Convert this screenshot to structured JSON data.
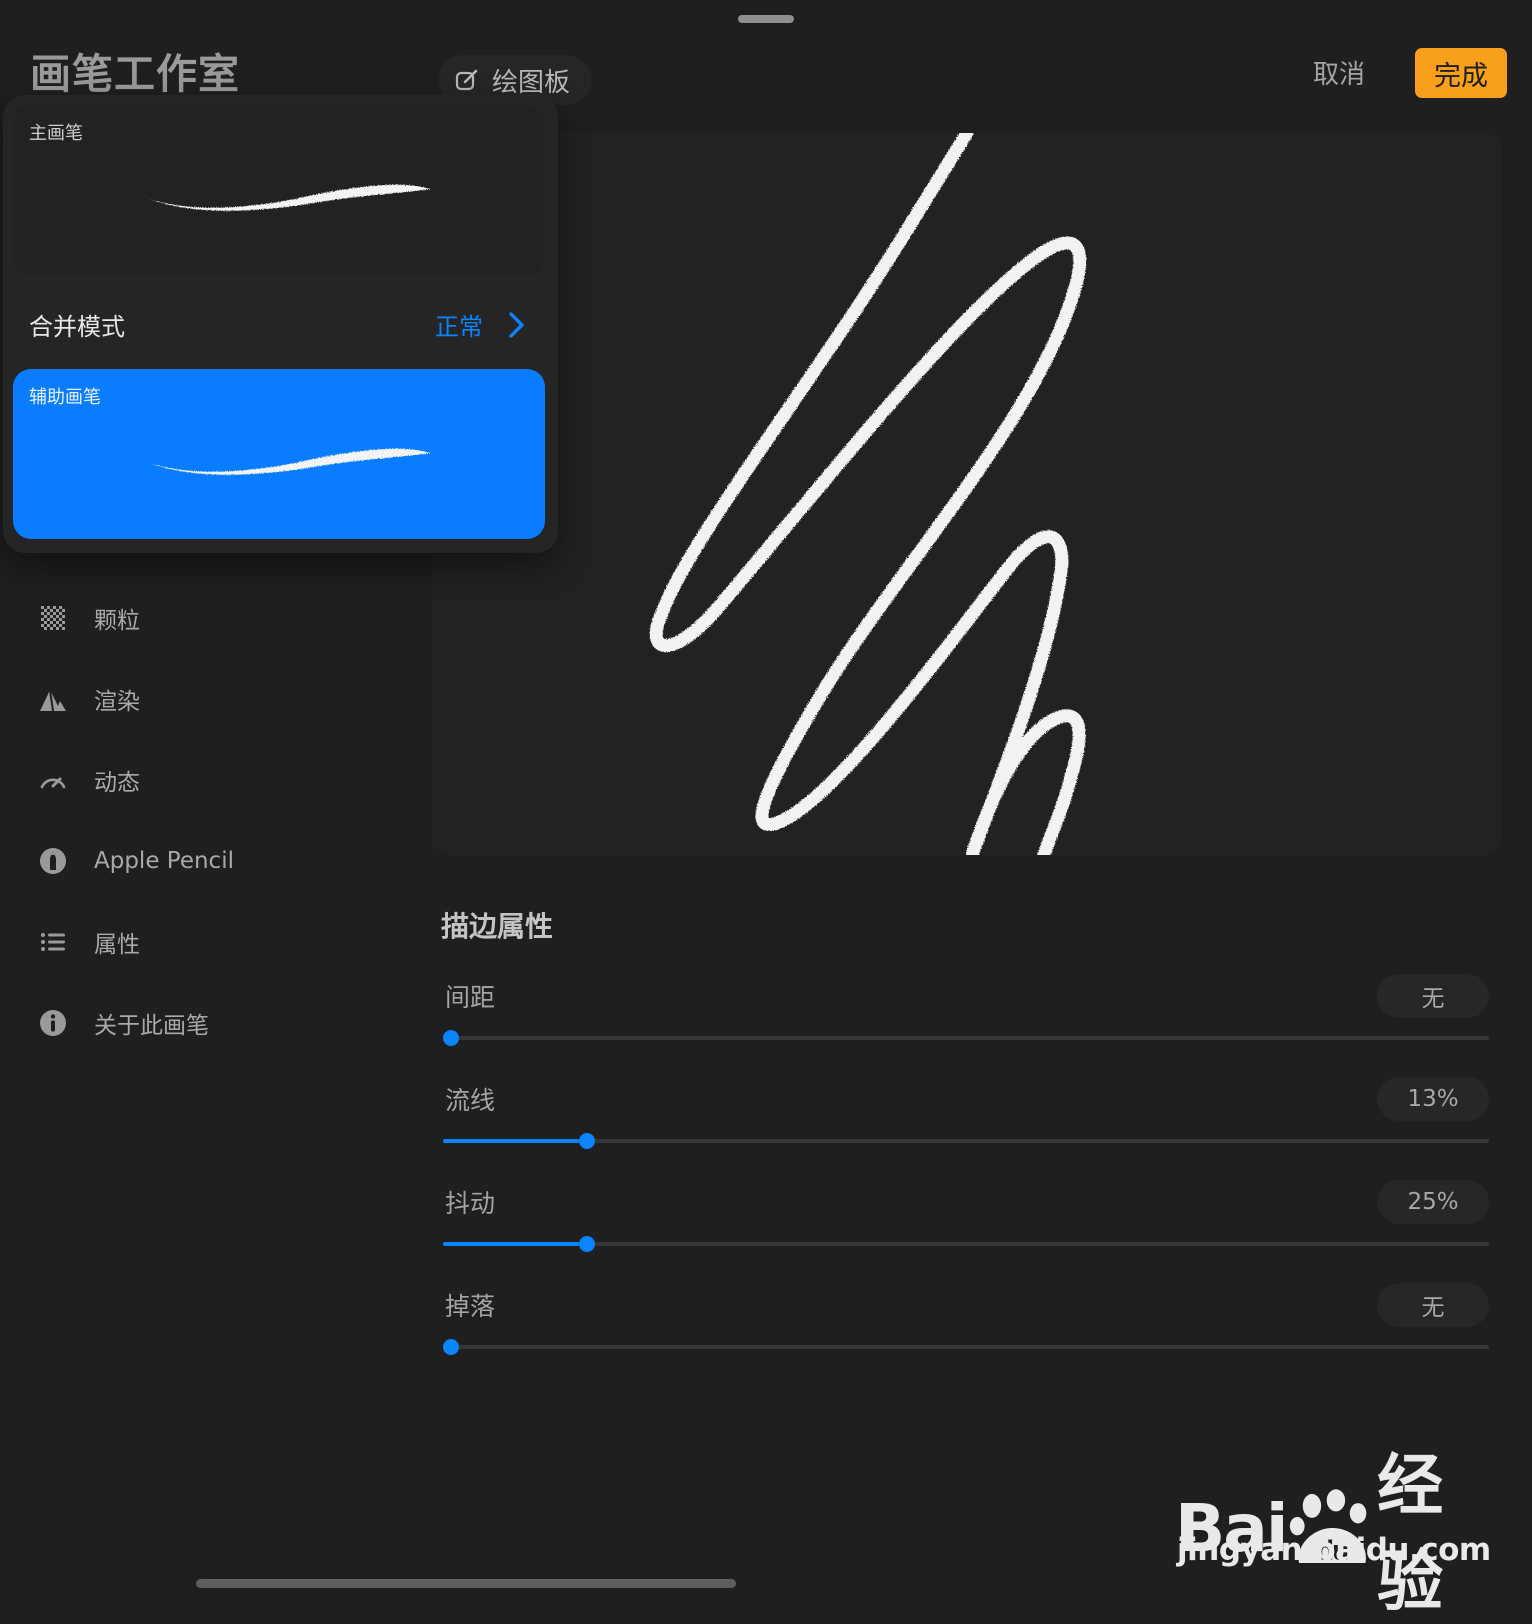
{
  "header": {
    "title": "画笔工作室",
    "canvas_button": "绘图板",
    "cancel": "取消",
    "done": "完成"
  },
  "popover": {
    "primary_brush_label": "主画笔",
    "blend_mode_label": "合并模式",
    "blend_mode_value": "正常",
    "secondary_brush_label": "辅助画笔"
  },
  "sidebar": {
    "items": [
      {
        "label": "颗粒",
        "icon": "grain-icon"
      },
      {
        "label": "渲染",
        "icon": "render-icon"
      },
      {
        "label": "动态",
        "icon": "dynamics-icon"
      },
      {
        "label": "Apple Pencil",
        "icon": "apple-pencil-icon"
      },
      {
        "label": "属性",
        "icon": "list-icon"
      },
      {
        "label": "关于此画笔",
        "icon": "info-icon"
      }
    ]
  },
  "stroke_properties": {
    "title": "描边属性",
    "sliders": [
      {
        "label": "间距",
        "value": "无",
        "level": 0.0
      },
      {
        "label": "流线",
        "value": "13%",
        "level": 0.13
      },
      {
        "label": "抖动",
        "value": "25%",
        "level": 0.13
      },
      {
        "label": "掉落",
        "value": "无",
        "level": 0.0
      }
    ]
  },
  "watermark": {
    "logo_text": "Bai",
    "logo_inner": "du",
    "logo_suffix": "经验",
    "url": "jingyan.baidu.com"
  },
  "colors": {
    "accent": "#0a84ff",
    "done": "#f8a01b",
    "background": "#1f1f20"
  }
}
